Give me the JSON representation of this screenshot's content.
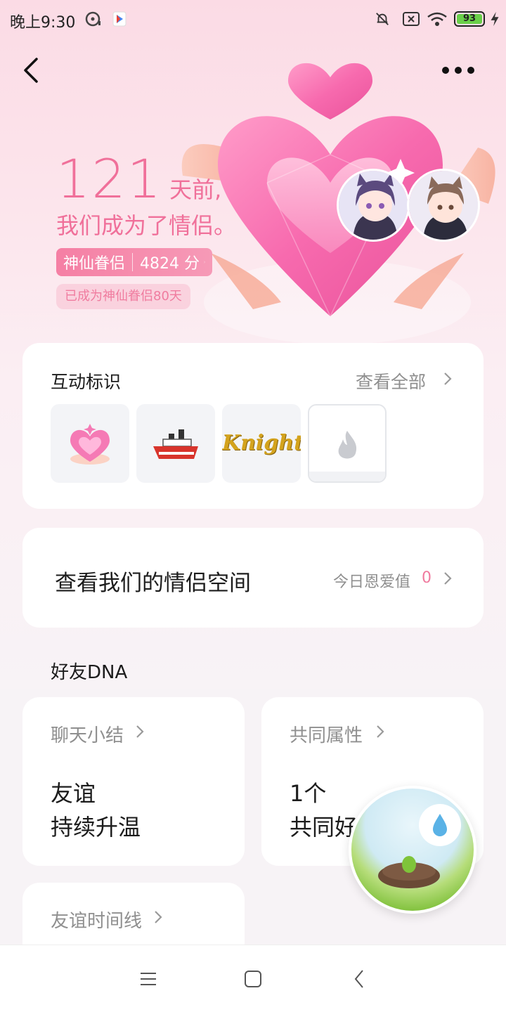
{
  "status_bar": {
    "time": "晚上9:30",
    "battery": "93"
  },
  "hero": {
    "days": "121",
    "days_suffix": "天前,",
    "couple_text": "我们成为了情侣。",
    "level_name": "神仙眷侣",
    "level_score": "4824 分",
    "sub_badge": "已成为神仙眷侣80天"
  },
  "interaction_marks": {
    "title": "互动标识",
    "see_all": "查看全部",
    "badges": [
      "heart-gem-badge-icon",
      "ship-badge-icon",
      "knight-badge-icon",
      "flame-badge-icon"
    ],
    "knight_text": "Knight"
  },
  "couple_space": {
    "title": "查看我们的情侣空间",
    "love_label": "今日恩爱值",
    "love_value": "0"
  },
  "friend_dna": {
    "title": "好友DNA",
    "chat_summary": {
      "title": "聊天小结",
      "line1": "友谊",
      "line2": "持续升温"
    },
    "common_attrs": {
      "title": "共同属性",
      "line1": "1个",
      "line2": "共同好"
    },
    "timeline": {
      "title": "友谊时间线"
    }
  },
  "colors": {
    "accent": "#f0709a",
    "badge_gradient": "#f57fa4"
  }
}
